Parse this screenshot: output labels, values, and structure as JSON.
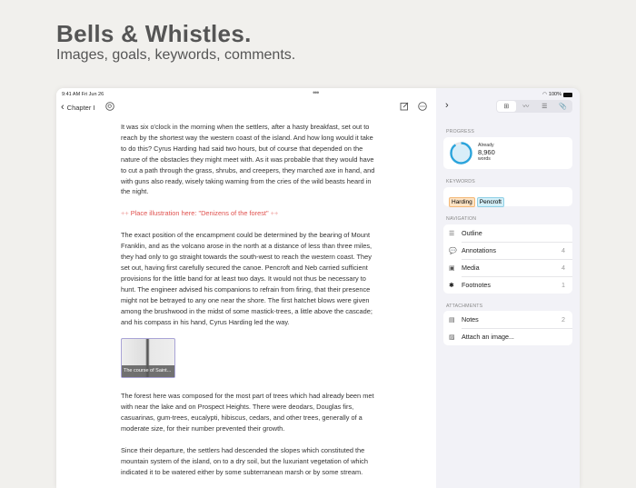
{
  "hero": {
    "title": "Bells & Whistles.",
    "subtitle": "Images, goals, keywords, comments."
  },
  "status": {
    "time": "9:41 AM  Fri Jun 26",
    "battery": "100%"
  },
  "toolbar": {
    "back_label": "Chapter I"
  },
  "editor": {
    "para1": [
      "It was six o'clock in the morning when the settlers, after a hasty breakfast, set out to",
      "reach by the shortest way the western coast of the island. And how long would it take",
      "to do this? Cyrus Harding had said two hours, but of course that depended on the",
      "nature of the obstacles they might meet with. As it was probable that they would have",
      "to cut a path through the grass, shrubs, and creepers, they marched axe in hand, and",
      "with guns also ready, wisely taking warning from the cries of the wild beasts heard in",
      "the night."
    ],
    "placeholder_arrow_left": "++",
    "placeholder": "Place illustration here: \"Denizens of the forest\"",
    "placeholder_arrow_right": "++",
    "para2": [
      "The exact position of the encampment could be determined by the bearing of Mount",
      "Franklin, and as the volcano arose in the north at a distance of less than three miles,",
      "they had only to go straight towards the south-west to reach the western coast. They",
      "set out, having first carefully secured the canoe. Pencroft and Neb carried sufficient",
      "provisions for the little band for at least two days. It would not thus be necessary to",
      "hunt. The engineer advised his companions to refrain from firing, that their presence",
      "might not be betrayed to any one near the shore. The first hatchet blows were given",
      "among the brushwood in the midst of some mastick-trees, a little above the cascade;",
      "and his compass in his hand, Cyrus Harding led the way."
    ],
    "image_caption": "The course of Saint...",
    "para3": [
      "The forest here was composed for the most part of trees which had already been met",
      "with near the lake and on Prospect Heights. There were deodars, Douglas firs,",
      "casuarinas, gum-trees, eucalypti, hibiscus, cedars, and other trees, generally of a",
      "moderate size, for their number prevented their growth."
    ],
    "para4": [
      "Since their departure, the settlers had descended the slopes which constituted the",
      "mountain system of the island, on to a dry soil, but the luxuriant vegetation of which",
      "indicated it to be watered either by some subterranean marsh or by some stream."
    ]
  },
  "sidebar": {
    "progress_label": "PROGRESS",
    "progress_prefix": "Already",
    "progress_value": "8,960",
    "progress_unit": "words",
    "progress_fraction": 0.9,
    "keywords_label": "KEYWORDS",
    "keywords": [
      {
        "text": "Harding",
        "bg": "#fde3c4",
        "border": "#f3b877"
      },
      {
        "text": "Pencroft",
        "bg": "#d3eff8",
        "border": "#8fd0e6"
      }
    ],
    "navigation_label": "NAVIGATION",
    "navigation": [
      {
        "label": "Outline",
        "icon": "☰",
        "count": ""
      },
      {
        "label": "Annotations",
        "icon": "💬",
        "count": "4"
      },
      {
        "label": "Media",
        "icon": "▣",
        "count": "4"
      },
      {
        "label": "Footnotes",
        "icon": "✱",
        "count": "1"
      }
    ],
    "attachments_label": "ATTACHMENTS",
    "attachments": [
      {
        "label": "Notes",
        "icon": "▤",
        "count": "2"
      },
      {
        "label": "Attach an image...",
        "icon": "▨",
        "count": ""
      }
    ]
  },
  "colors": {
    "accent": "#2aa4dc",
    "ring_bg": "#d8eef9",
    "placeholder": "#e0524f"
  }
}
